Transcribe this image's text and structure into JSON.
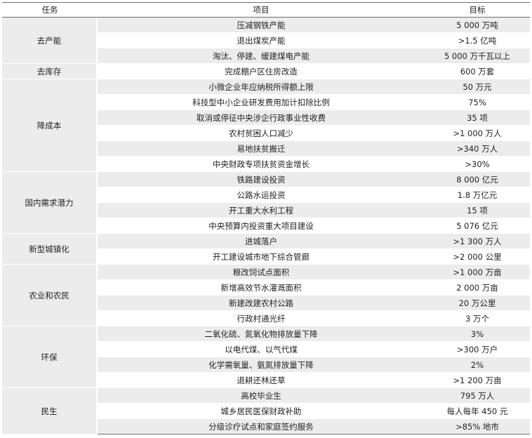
{
  "headers": {
    "task": "任务",
    "item": "项目",
    "target": "目标"
  },
  "groups": [
    {
      "task": "去产能",
      "rows": [
        {
          "item": "压减钢铁产能",
          "target": "5 000 万吨"
        },
        {
          "item": "退出煤炭产能",
          "target": ">1.5 亿吨"
        },
        {
          "item": "淘汰、停建、缓建煤电产能",
          "target": "5 000 万千瓦以上"
        }
      ]
    },
    {
      "task": "去库存",
      "rows": [
        {
          "item": "完成棚户区住房改造",
          "target": "600 万套"
        }
      ]
    },
    {
      "task": "降成本",
      "rows": [
        {
          "item": "小微企业年应纳税所得额上限",
          "target": "50 万元"
        },
        {
          "item": "科技型中小企业研发费用加计扣除比例",
          "target": "75%"
        },
        {
          "item": "取消或停征中央涉企行政事业性收费",
          "target": "35 项"
        },
        {
          "item": "农村贫困人口减少",
          "target": ">1 000 万人"
        },
        {
          "item": "易地扶贫搬迁",
          "target": ">340 万人"
        },
        {
          "item": "中央财政专项扶贫资金增长",
          "target": ">30%"
        }
      ]
    },
    {
      "task": "国内需求潜力",
      "rows": [
        {
          "item": "铁路建设投资",
          "target": "8 000 亿元"
        },
        {
          "item": "公路水运投资",
          "target": "1.8 万亿元"
        },
        {
          "item": "开工重大水利工程",
          "target": "15 项"
        },
        {
          "item": "中央预算内投资重大项目建设",
          "target": "5 076 亿元"
        }
      ]
    },
    {
      "task": "新型城镇化",
      "rows": [
        {
          "item": "进城落户",
          "target": ">1 300 万人"
        },
        {
          "item": "开工建设城市地下综合管廊",
          "target": ">2 000 公里"
        }
      ]
    },
    {
      "task": "农业和农民",
      "rows": [
        {
          "item": "粮改饲试点面积",
          "target": ">1 000 万亩"
        },
        {
          "item": "新增高效节水灌溉面积",
          "target": "2 000 万亩"
        },
        {
          "item": "新建改建农村公路",
          "target": "20 万公里"
        },
        {
          "item": "行政村通光纤",
          "target": "3 万个"
        }
      ]
    },
    {
      "task": "环保",
      "rows": [
        {
          "item": "二氧化硫、氮氧化物排放量下降",
          "target": "3%"
        },
        {
          "item": "以电代煤、以气代煤",
          "target": ">300 万户"
        },
        {
          "item": "化学需氧量、氨氮排放量下降",
          "target": "2%"
        },
        {
          "item": "退耕还林还草",
          "target": ">1 200 万亩"
        }
      ]
    },
    {
      "task": "民生",
      "rows": [
        {
          "item": "高校毕业生",
          "target": "795 万人"
        },
        {
          "item": "城乡居民医保财政补助",
          "target": "每人每年 450 元"
        },
        {
          "item": "分级诊疗试点和家庭签约服务",
          "target": ">85% 地市"
        }
      ]
    }
  ]
}
